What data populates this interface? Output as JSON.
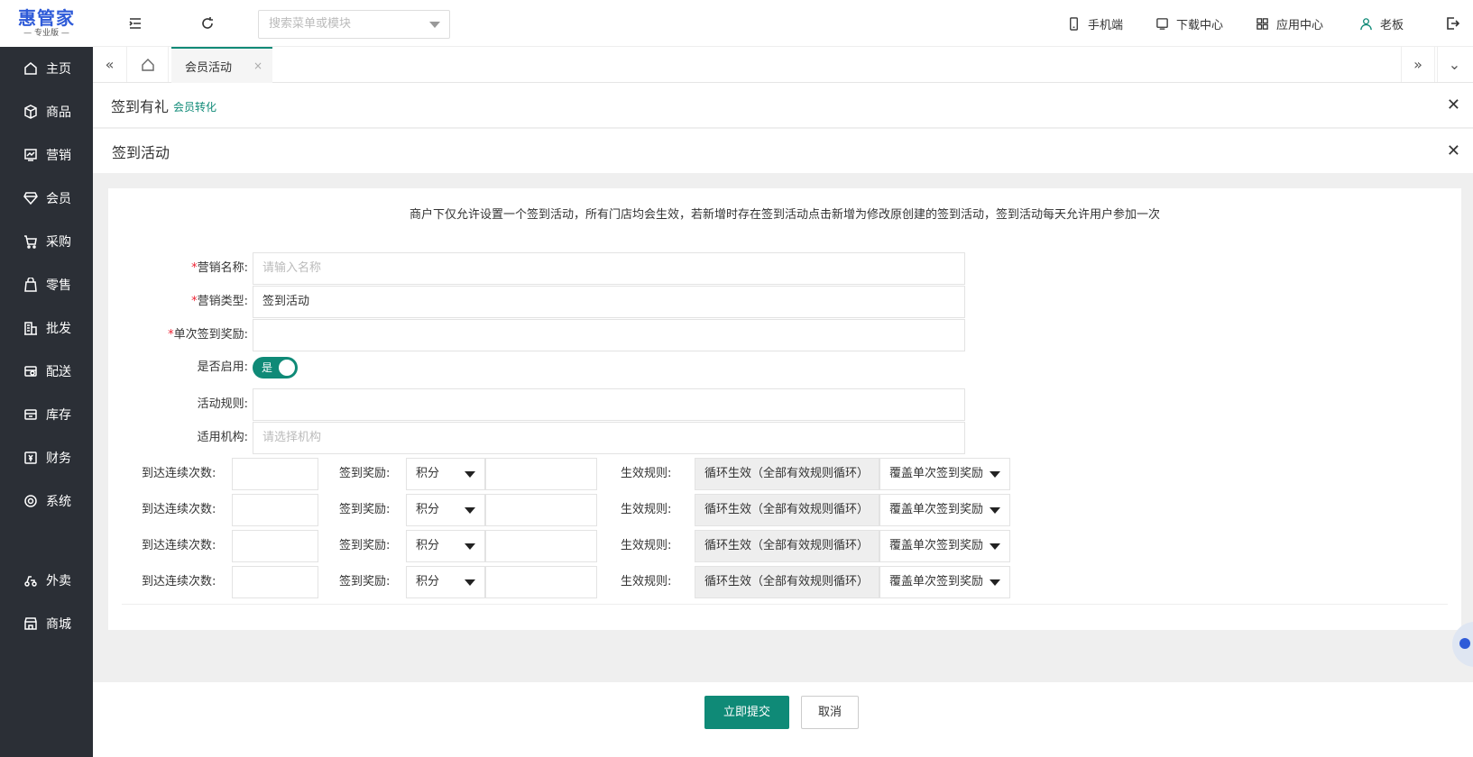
{
  "brand": {
    "name": "惠管家",
    "edition": "— 专业版 —"
  },
  "sidebar": {
    "items": [
      {
        "label": "主页",
        "icon": "home-icon"
      },
      {
        "label": "商品",
        "icon": "box-icon"
      },
      {
        "label": "营销",
        "icon": "chart-icon"
      },
      {
        "label": "会员",
        "icon": "diamond-icon"
      },
      {
        "label": "采购",
        "icon": "cart-icon"
      },
      {
        "label": "零售",
        "icon": "bag-icon"
      },
      {
        "label": "批发",
        "icon": "building-icon"
      },
      {
        "label": "配送",
        "icon": "delivery-icon"
      },
      {
        "label": "库存",
        "icon": "inventory-icon"
      },
      {
        "label": "财务",
        "icon": "finance-icon"
      },
      {
        "label": "系统",
        "icon": "settings-icon"
      }
    ],
    "extra_items": [
      {
        "label": "外卖",
        "icon": "takeout-icon"
      },
      {
        "label": "商城",
        "icon": "store-icon"
      }
    ]
  },
  "topbar": {
    "search_placeholder": "搜索菜单或模块",
    "mobile": "手机端",
    "download": "下载中心",
    "apps": "应用中心",
    "user": "老板"
  },
  "tabs": {
    "active": "会员活动",
    "close": "×"
  },
  "panel1": {
    "title": "签到有礼",
    "tag": "会员转化"
  },
  "panel2": {
    "title": "签到活动"
  },
  "notice": "商户下仅允许设置一个签到活动，所有门店均会生效，若新增时存在签到活动点击新增为修改原创建的签到活动，签到活动每天允许用户参加一次",
  "form": {
    "name_label": "营销名称:",
    "name_placeholder": "请输入名称",
    "type_label": "营销类型:",
    "type_value": "签到活动",
    "reward_label": "单次签到奖励:",
    "reward_value": "",
    "enabled_label": "是否启用:",
    "enabled_text": "是",
    "enabled": true,
    "rules_label": "活动规则:",
    "rules_value": "",
    "org_label": "适用机构:",
    "org_placeholder": "请选择机构"
  },
  "reward_rows_labels": {
    "days": "到达连续次数:",
    "reward": "签到奖励:",
    "effect": "生效规则:"
  },
  "reward_rows": [
    {
      "days": "",
      "reward_type": "积分",
      "reward_amount": "",
      "effect": "循环生效（全部有效规则循环）",
      "mode": "覆盖单次签到奖励"
    },
    {
      "days": "",
      "reward_type": "积分",
      "reward_amount": "",
      "effect": "循环生效（全部有效规则循环）",
      "mode": "覆盖单次签到奖励"
    },
    {
      "days": "",
      "reward_type": "积分",
      "reward_amount": "",
      "effect": "循环生效（全部有效规则循环）",
      "mode": "覆盖单次签到奖励"
    },
    {
      "days": "",
      "reward_type": "积分",
      "reward_amount": "",
      "effect": "循环生效（全部有效规则循环）",
      "mode": "覆盖单次签到奖励"
    }
  ],
  "footer": {
    "submit": "立即提交",
    "cancel": "取消"
  },
  "colors": {
    "accent": "#0f8a77",
    "sidebar": "#2b2f36",
    "brand": "#2f5bd8",
    "required": "#e23"
  }
}
